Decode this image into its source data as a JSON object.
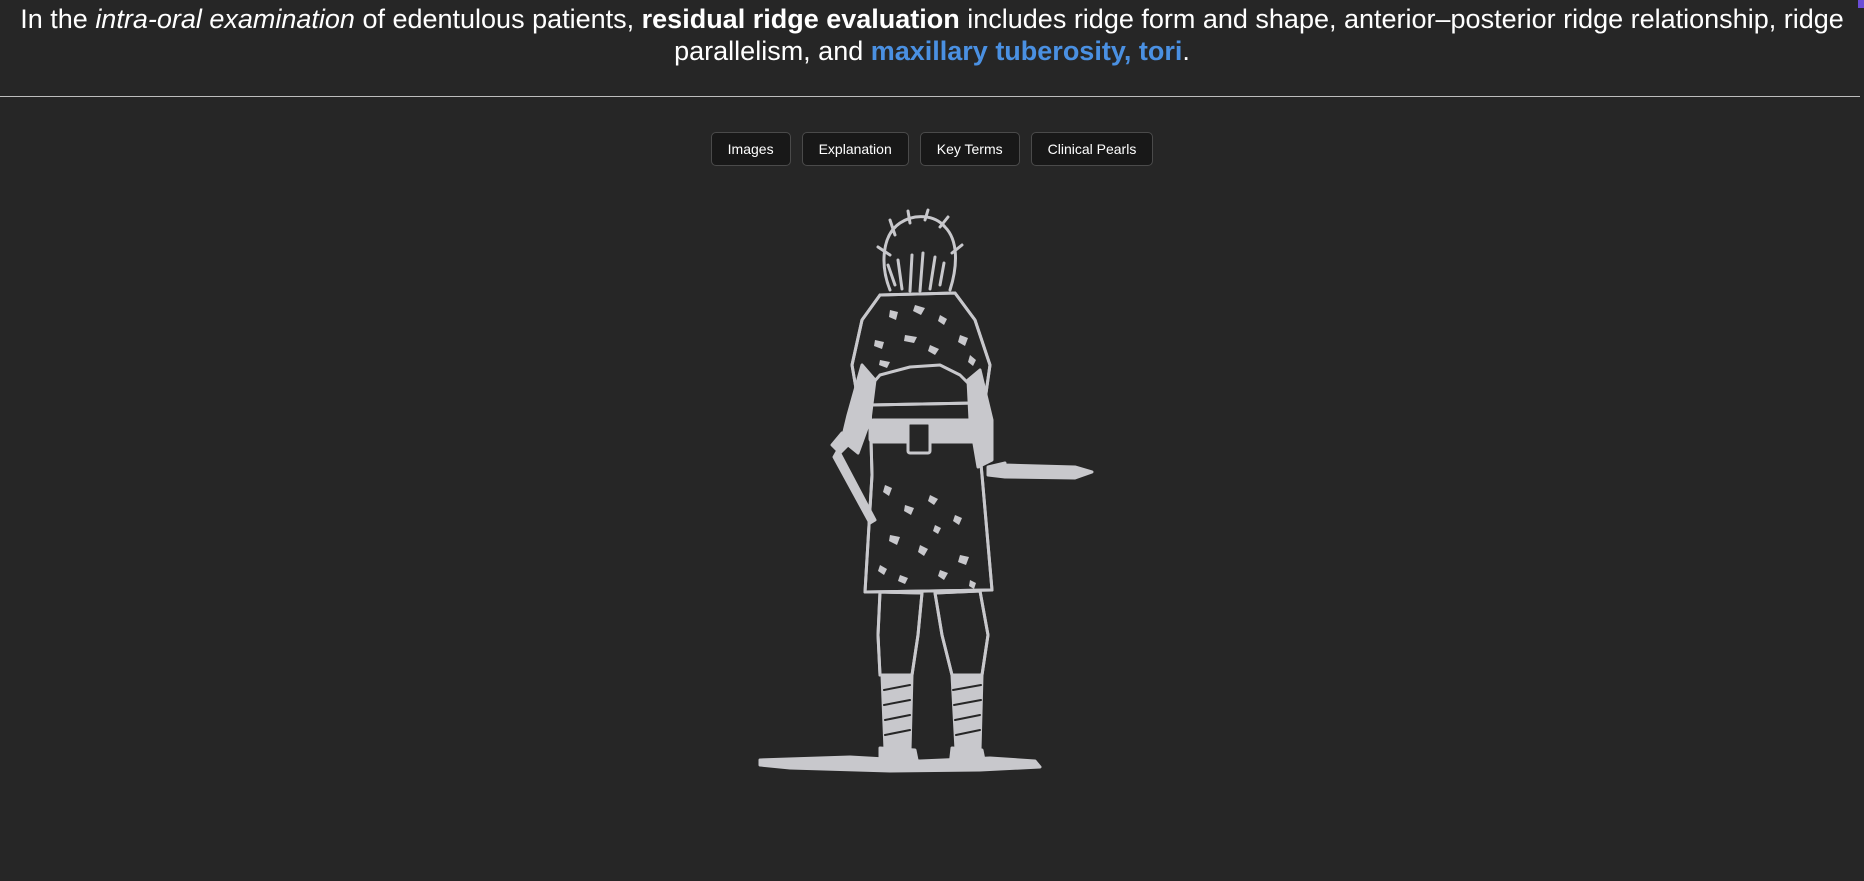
{
  "heading": {
    "part1": "In the ",
    "italic": "intra-oral examination",
    "part2": " of edentulous patients, ",
    "bold": "residual ridge evaluation",
    "part3": " includes ridge form and shape, anterior–posterior ridge relationship, ridge parallelism, and ",
    "highlight": "maxillary tuberosity, tori",
    "part4": "."
  },
  "tabs": [
    {
      "label": "Images"
    },
    {
      "label": "Explanation"
    },
    {
      "label": "Key Terms"
    },
    {
      "label": "Clinical Pearls"
    }
  ],
  "figure": {
    "subject": "warrior-back-view-illustration",
    "fill_color": "#c8c8cc"
  },
  "colors": {
    "background": "#262626",
    "highlight": "#4a90e2",
    "button_bg": "#181818"
  }
}
